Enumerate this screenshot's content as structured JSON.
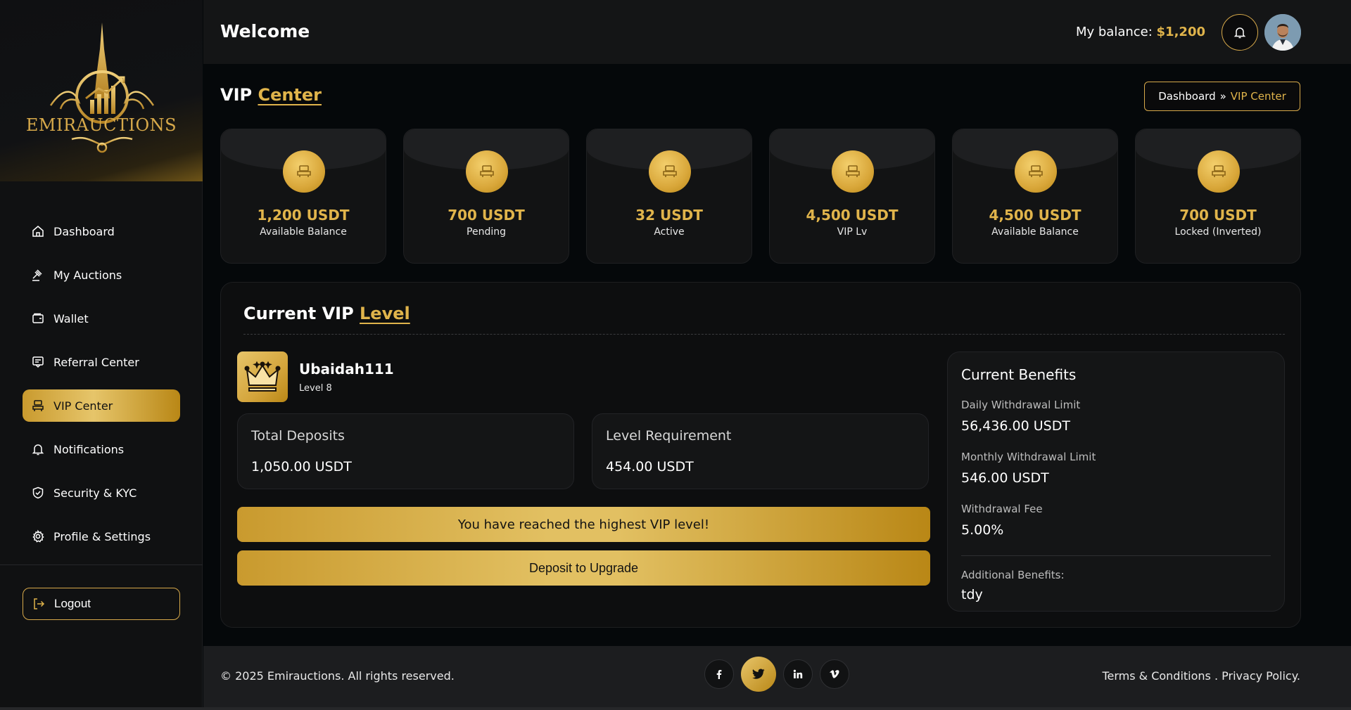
{
  "brand": {
    "name": "EMIRAUCTIONS"
  },
  "sidebar": {
    "items": [
      {
        "label": "Dashboard",
        "icon": "home-icon",
        "active": false
      },
      {
        "label": "My Auctions",
        "icon": "gavel-icon",
        "active": false
      },
      {
        "label": "Wallet",
        "icon": "wallet-icon",
        "active": false
      },
      {
        "label": "Referral Center",
        "icon": "referral-icon",
        "active": false
      },
      {
        "label": "VIP Center",
        "icon": "vip-icon",
        "active": true
      },
      {
        "label": "Notifications",
        "icon": "bell-icon",
        "active": false
      },
      {
        "label": "Security & KYC",
        "icon": "shield-icon",
        "active": false
      },
      {
        "label": "Profile & Settings",
        "icon": "gear-icon",
        "active": false
      }
    ],
    "logout_label": "Logout"
  },
  "header": {
    "welcome": "Welcome",
    "balance_label": "My balance: ",
    "balance_amount": "$1,200"
  },
  "page": {
    "title_main": "VIP ",
    "title_accent": "Center",
    "breadcrumb": {
      "home": "Dashboard",
      "separator": "»",
      "current": "VIP Center"
    }
  },
  "stats": [
    {
      "value": "1,200 USDT",
      "label": "Available Balance"
    },
    {
      "value": "700 USDT",
      "label": "Pending"
    },
    {
      "value": "32 USDT",
      "label": "Active"
    },
    {
      "value": "4,500 USDT",
      "label": "VIP Lv"
    },
    {
      "value": "4,500 USDT",
      "label": "Available Balance"
    },
    {
      "value": "700 USDT",
      "label": "Locked (Inverted)"
    }
  ],
  "vip": {
    "title_main": "Current VIP ",
    "title_accent": "Level",
    "username": "Ubaidah111",
    "level": "Level 8",
    "total_deposits_label": "Total Deposits",
    "total_deposits_value": "1,050.00 USDT",
    "level_requirement_label": "Level Requirement",
    "level_requirement_value": "454.00 USDT",
    "highest_level_message": "You have reached the highest VIP level!",
    "upgrade_button": "Deposit to Upgrade"
  },
  "benefits": {
    "title": "Current Benefits",
    "daily_label": "Daily Withdrawal Limit",
    "daily_value": "56,436.00 USDT",
    "monthly_label": "Monthly Withdrawal Limit",
    "monthly_value": "546.00 USDT",
    "fee_label": "Withdrawal Fee",
    "fee_value": "5.00%",
    "additional_label": "Additional Benefits:",
    "additional_value": "tdy"
  },
  "footer": {
    "copyright": "© 2025 Emirauctions. All rights reserved.",
    "socials": [
      {
        "glyph": "f",
        "icon": "facebook-icon"
      },
      {
        "glyph": "t",
        "icon": "twitter-icon"
      },
      {
        "glyph": "in",
        "icon": "linkedin-icon"
      },
      {
        "glyph": "v",
        "icon": "vimeo-icon"
      }
    ],
    "links": "Terms & Conditions . Privacy Policy."
  },
  "colors": {
    "gold": "#e0b44b",
    "background": "#05080a",
    "panel": "#141516"
  }
}
